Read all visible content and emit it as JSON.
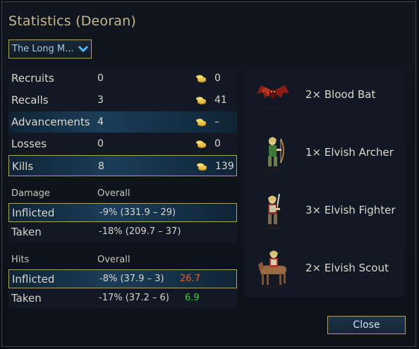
{
  "window": {
    "title": "Statistics (Deoran)"
  },
  "scenario_select": {
    "value": "The Long M..."
  },
  "summary": [
    {
      "label": "Recruits",
      "count": "0",
      "gold": "0"
    },
    {
      "label": "Recalls",
      "count": "3",
      "gold": "41"
    },
    {
      "label": "Advancements",
      "count": "4",
      "gold": "–"
    },
    {
      "label": "Losses",
      "count": "0",
      "gold": "0"
    },
    {
      "label": "Kills",
      "count": "8",
      "gold": "139"
    }
  ],
  "damage": {
    "header": "Damage",
    "col": "Overall",
    "inflicted": {
      "label": "Inflicted",
      "value": "-9% (331.9 – 29)"
    },
    "taken": {
      "label": "Taken",
      "value": "-18% (209.7 – 37)"
    }
  },
  "hits": {
    "header": "Hits",
    "col": "Overall",
    "inflicted": {
      "label": "Inflicted",
      "value": "-8% (37.9 – 3)",
      "extra": "26.7"
    },
    "taken": {
      "label": "Taken",
      "value": "-17% (37.2 – 6)",
      "extra": "6.9"
    }
  },
  "colors": {
    "bad": "#e0602f",
    "good": "#3fcf3a",
    "accent": "#b59f5e"
  },
  "units": [
    {
      "name": "2× Blood Bat",
      "icon": "blood-bat-sprite"
    },
    {
      "name": "1× Elvish Archer",
      "icon": "elvish-archer-sprite"
    },
    {
      "name": "3× Elvish Fighter",
      "icon": "elvish-fighter-sprite"
    },
    {
      "name": "2× Elvish Scout",
      "icon": "elvish-scout-sprite"
    }
  ],
  "buttons": {
    "close": "Close"
  }
}
